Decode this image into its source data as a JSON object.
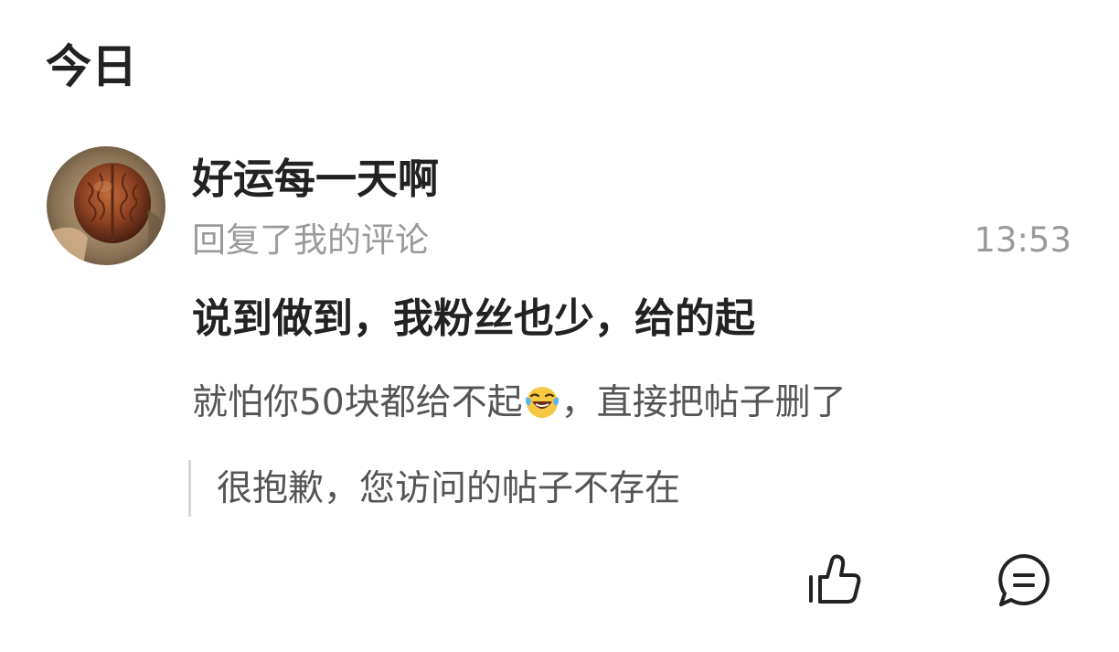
{
  "section": {
    "title": "今日"
  },
  "notification": {
    "username": "好运每一天啊",
    "action": "回复了我的评论",
    "time": "13:53",
    "reply": "说到做到，我粉丝也少，给的起",
    "quoted_before_emoji": "就怕你50块都给不起",
    "quoted_emoji": "laughing-tears-emoji",
    "quoted_after_emoji": "，直接把帖子删了",
    "deleted_notice": "很抱歉，您访问的帖子不存在"
  },
  "actions": {
    "like_icon": "thumbs-up-icon",
    "comment_icon": "comment-bubble-icon"
  },
  "colors": {
    "primary_text": "#222222",
    "secondary_text": "#9a9a9a",
    "quote_text": "#555555",
    "quote_bar": "#d6d6d6"
  }
}
